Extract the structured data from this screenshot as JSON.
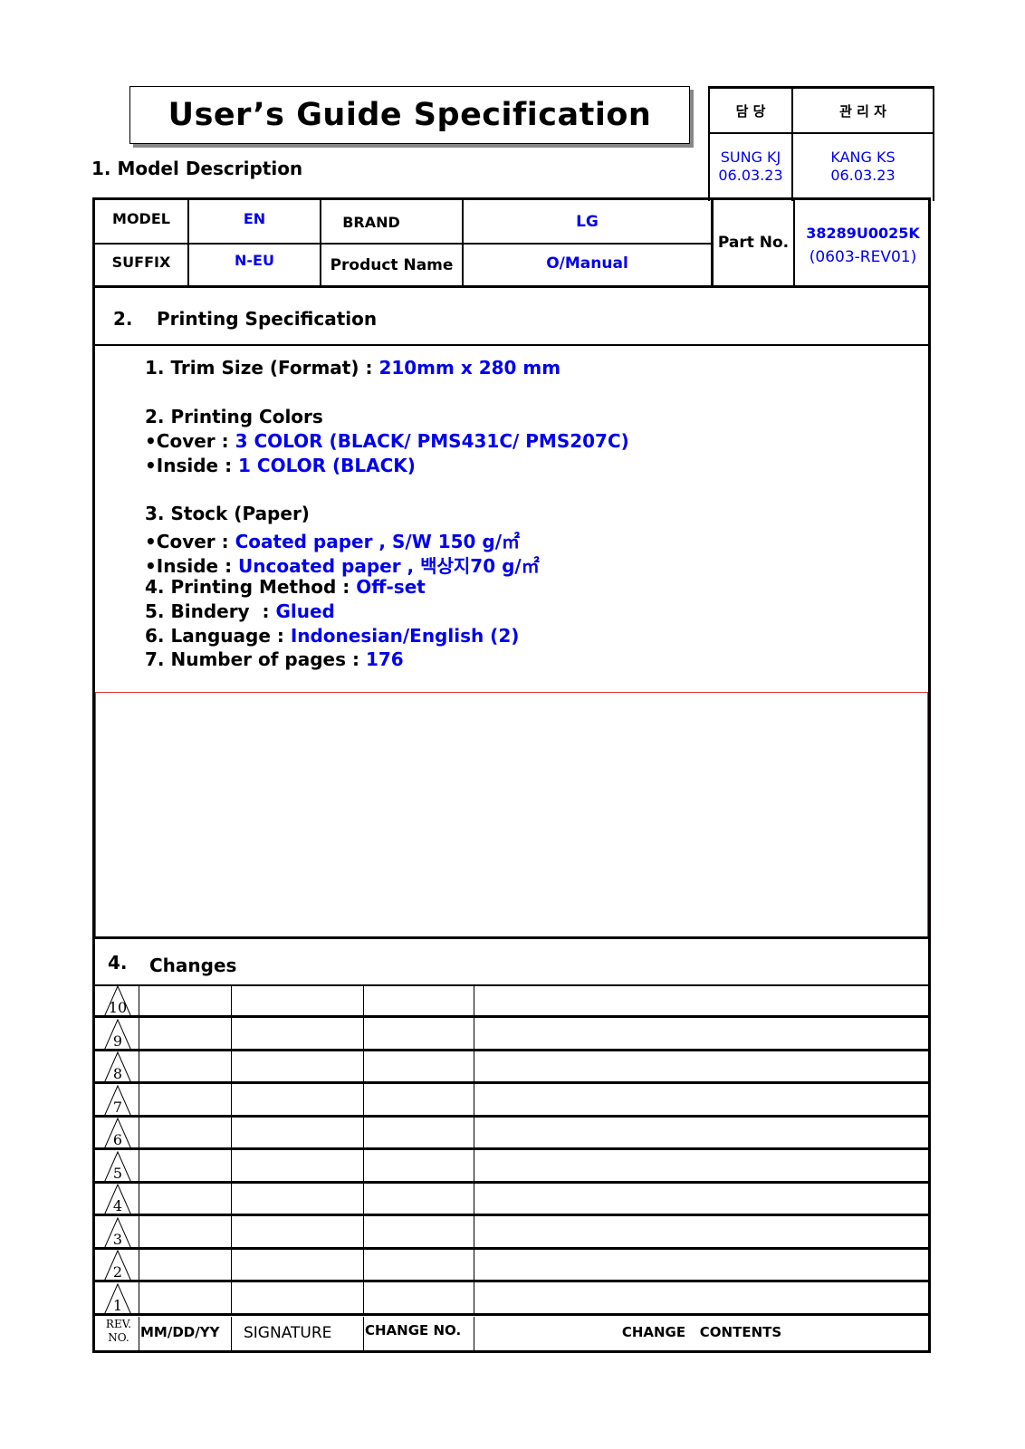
{
  "title": "User’s Guide Specification",
  "model_description": {
    "heading": "1. Model Description",
    "model_label": "MODEL",
    "model_value": "EN",
    "suffix_label": "SUFFIX",
    "suffix_value": "N-EU",
    "brand_label": "BRAND",
    "brand_value": "LG",
    "product_name_label": "Product Name",
    "product_name_value": "O/Manual",
    "part_no_label": "Part No.",
    "part_no_value": "38289U0025K",
    "part_no_rev": "(0603-REV01)"
  },
  "approval": {
    "col1_header": "담  당",
    "col2_header": "관 리 자",
    "col1_name": "SUNG KJ",
    "col1_date": "06.03.23",
    "col2_name": "KANG KS",
    "col2_date": "06.03.23"
  },
  "printing_spec": {
    "number": "2.",
    "heading": "Printing Specification",
    "lines": [
      {
        "label": "1. Trim Size (Format) : ",
        "value": "210mm x 280 mm"
      },
      {
        "label": "2. Printing Colors",
        "value": ""
      },
      {
        "label": "•Cover : ",
        "value": "3 COLOR (BLACK/ PMS431C/ PMS207C)"
      },
      {
        "label": "•Inside : ",
        "value": "1 COLOR (BLACK)"
      },
      {
        "label": "3. Stock (Paper)",
        "value": ""
      },
      {
        "label": "•Cover : ",
        "value": "Coated paper , S/W 150 g/㎡"
      },
      {
        "label": "•Inside : ",
        "value": "Uncoated paper , 백상지70 g/㎡"
      },
      {
        "label": "4. Printing Method : ",
        "value": "Off-set"
      },
      {
        "label": "5. Bindery  : ",
        "value": "Glued"
      },
      {
        "label": "6. Language : ",
        "value": "Indonesian/English (2)"
      },
      {
        "label": "7. Number of pages : ",
        "value": "176"
      }
    ]
  },
  "changes": {
    "number": "4.",
    "heading": "Changes",
    "rev_numbers": [
      "10",
      "9",
      "8",
      "7",
      "6",
      "5",
      "4",
      "3",
      "2",
      "1"
    ],
    "columns": {
      "rev_no": "REV. NO.",
      "date": "MM/DD/YY",
      "signature": "SIGNATURE",
      "change_no": "CHANGE NO.",
      "contents": "CHANGE   CONTENTS"
    }
  },
  "colors": {
    "value_text": "#0000ee",
    "red_frame": "#dd3333"
  }
}
